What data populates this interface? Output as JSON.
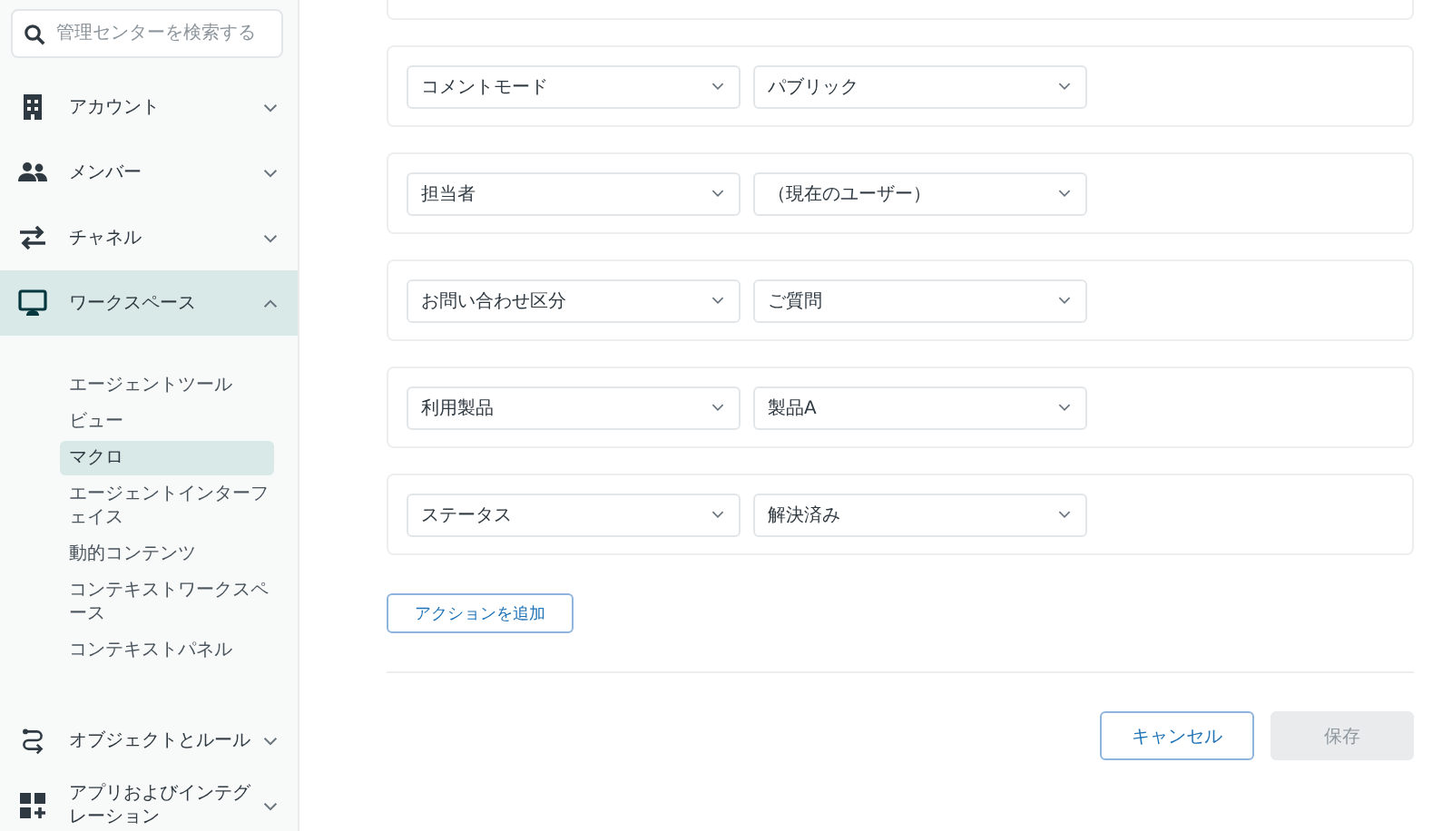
{
  "sidebar": {
    "search": {
      "placeholder": "管理センターを検索する"
    },
    "items": [
      {
        "label": "アカウント",
        "selected": false,
        "expanded": false
      },
      {
        "label": "メンバー",
        "selected": false,
        "expanded": false
      },
      {
        "label": "チャネル",
        "selected": false,
        "expanded": false
      },
      {
        "label": "ワークスペース",
        "selected": true,
        "expanded": true,
        "children": [
          {
            "label": "エージェントツール",
            "selected": false
          },
          {
            "label": "ビュー",
            "selected": false
          },
          {
            "label": "マクロ",
            "selected": true
          },
          {
            "label": "エージェントインターフェイス",
            "selected": false
          },
          {
            "label": "動的コンテンツ",
            "selected": false
          },
          {
            "label": "コンテキストワークスペース",
            "selected": false
          },
          {
            "label": "コンテキストパネル",
            "selected": false
          }
        ]
      },
      {
        "label": "オブジェクトとルール",
        "selected": false,
        "expanded": false
      },
      {
        "label": "アプリおよびインテグレーション",
        "selected": false,
        "expanded": false
      }
    ]
  },
  "actions": [
    {
      "field": "コメントモード",
      "value": "パブリック"
    },
    {
      "field": "担当者",
      "value": "（現在のユーザー）"
    },
    {
      "field": "お問い合わせ区分",
      "value": "ご質問"
    },
    {
      "field": "利用製品",
      "value": "製品A"
    },
    {
      "field": "ステータス",
      "value": "解決済み"
    }
  ],
  "add_action": "アクションを追加",
  "buttons": [
    {
      "label": "キャンセル",
      "disabled": false
    },
    {
      "label": "保存",
      "disabled": true
    }
  ]
}
